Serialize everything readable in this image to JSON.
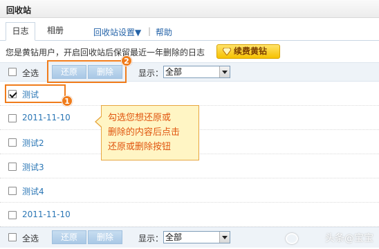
{
  "window": {
    "title": "回收站"
  },
  "tabs": [
    {
      "label": "日志",
      "active": true
    },
    {
      "label": "相册",
      "active": false
    }
  ],
  "links": {
    "settings": "回收站设置▼",
    "separator": "|",
    "help": "帮助"
  },
  "notice": "您是黄钻用户，开启回收站后保留最近一年删除的日志",
  "renew_button": "续费黄钻",
  "toolbar": {
    "select_all": "全选",
    "restore": "还原",
    "delete": "删除",
    "display_label": "显示：",
    "display_value": "全部"
  },
  "items": [
    {
      "title": "测试",
      "checked": true
    },
    {
      "title": "2011-11-10",
      "checked": false
    },
    {
      "title": "测试2",
      "checked": false
    },
    {
      "title": "测试3",
      "checked": false
    },
    {
      "title": "测试4",
      "checked": false
    },
    {
      "title": "2011-11-10",
      "checked": false
    }
  ],
  "annotations": {
    "badge_1": "1",
    "badge_2": "2",
    "tooltip_lines": [
      "勾选您想还原或",
      "删除的内容后点击",
      "还原或删除按钮"
    ]
  },
  "watermark": "头条@宝宝",
  "colors": {
    "accent_orange": "#f07c1b",
    "link_blue": "#2a76b5",
    "gold": "#f6c100",
    "button_blue": "#a9c8e6"
  }
}
